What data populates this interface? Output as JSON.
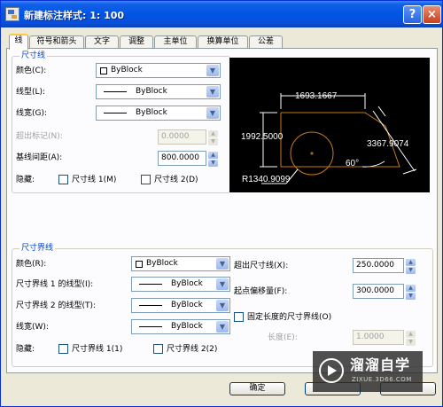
{
  "window": {
    "title": "新建标注样式: 1: 100",
    "help_label": "?",
    "close_label": "×"
  },
  "tabs": [
    {
      "label": "线"
    },
    {
      "label": "符号和箭头"
    },
    {
      "label": "文字"
    },
    {
      "label": "调整"
    },
    {
      "label": "主单位"
    },
    {
      "label": "换算单位"
    },
    {
      "label": "公差"
    }
  ],
  "dim_lines": {
    "title": "尺寸线",
    "color_label": "颜色(C):",
    "color_value": "ByBlock",
    "linetype_label": "线型(L):",
    "linetype_value": "ByBlock",
    "lineweight_label": "线宽(G):",
    "lineweight_value": "ByBlock",
    "extend_ticks_label": "超出标记(N):",
    "extend_ticks_value": "0.0000",
    "baseline_spacing_label": "基线间距(A):",
    "baseline_spacing_value": "800.0000",
    "suppress_label": "隐藏:",
    "suppress_1_label": "尺寸线 1(M)",
    "suppress_2_label": "尺寸线 2(D)"
  },
  "preview": {
    "dim_top": "1693.1667",
    "dim_left": "1992.5000",
    "dim_right": "3367.9074",
    "angle": "60°",
    "radius": "R1340.9099"
  },
  "ext_lines": {
    "title": "尺寸界线",
    "color_label": "颜色(R):",
    "color_value": "ByBlock",
    "linetype1_label": "尺寸界线 1 的线型(I):",
    "linetype1_value": "ByBlock",
    "linetype2_label": "尺寸界线 2 的线型(T):",
    "linetype2_value": "ByBlock",
    "lineweight_label": "线宽(W):",
    "lineweight_value": "ByBlock",
    "suppress_label": "隐藏:",
    "suppress_1_label": "尺寸界线 1(1)",
    "suppress_2_label": "尺寸界线 2(2)",
    "extend_beyond_label": "超出尺寸线(X):",
    "extend_beyond_value": "250.0000",
    "offset_label": "起点偏移量(F):",
    "offset_value": "300.0000",
    "fixed_length_label": "固定长度的尺寸界线(O)",
    "length_label": "长度(E):",
    "length_value": "1.0000"
  },
  "footer": {
    "ok_label": "确定"
  },
  "watermark": {
    "title": "溜溜自学",
    "url": "ZIXUE.3D66.COM"
  },
  "colors": {
    "preview_geometry": "#c87a1e",
    "preview_text": "#ffffff",
    "group_title": "#0046d5"
  }
}
